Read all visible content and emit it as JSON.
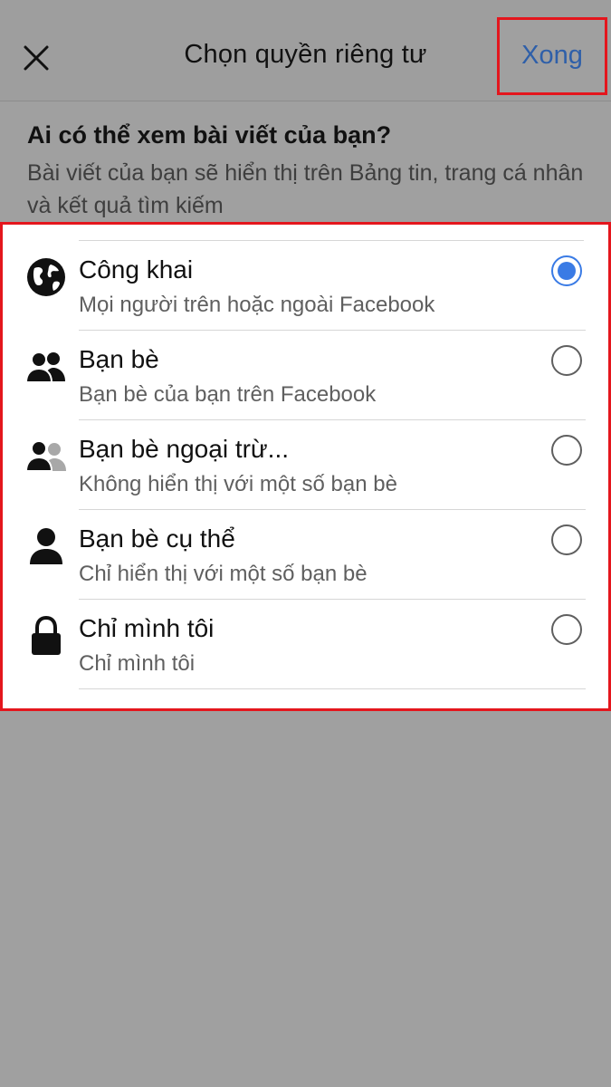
{
  "header": {
    "title": "Chọn quyền riêng tư",
    "done_label": "Xong",
    "close_icon": "close-icon"
  },
  "question": {
    "title": "Ai có thể xem bài viết của bạn?",
    "description": "Bài viết của bạn sẽ hiển thị trên Bảng tin, trang cá nhân và kết quả tìm kiếm"
  },
  "options": [
    {
      "icon": "globe-icon",
      "label": "Công khai",
      "sub": "Mọi người trên hoặc ngoài Facebook",
      "selected": true
    },
    {
      "icon": "friends-icon",
      "label": "Bạn bè",
      "sub": "Bạn bè của bạn trên Facebook",
      "selected": false
    },
    {
      "icon": "friends-except-icon",
      "label": "Bạn bè ngoại trừ...",
      "sub": "Không hiển thị với một số bạn bè",
      "selected": false
    },
    {
      "icon": "person-icon",
      "label": "Bạn bè cụ thể",
      "sub": "Chỉ hiển thị với một số bạn bè",
      "selected": false
    },
    {
      "icon": "lock-icon",
      "label": "Chỉ mình tôi",
      "sub": "Chỉ mình tôi",
      "selected": false
    }
  ],
  "colors": {
    "accent": "#3a7be5",
    "done_text": "#2e5fa9",
    "highlight_border": "#e4161d",
    "overlay": "#a0a0a0"
  }
}
